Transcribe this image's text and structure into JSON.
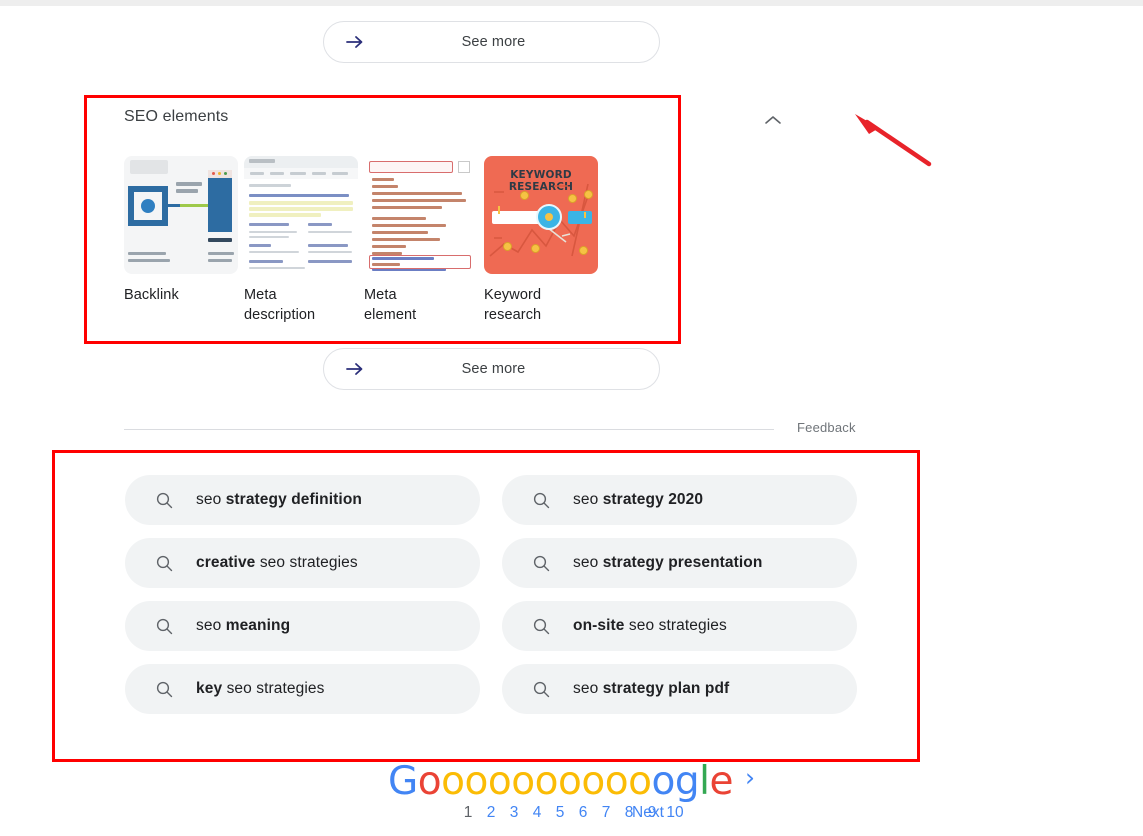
{
  "see_more_top": {
    "label": "See more",
    "icon": "arrow-right-icon"
  },
  "see_more_bottom": {
    "label": "See more",
    "icon": "arrow-right-icon"
  },
  "seo_elements": {
    "title": "SEO elements",
    "collapse_icon": "chevron-up-icon",
    "tiles": [
      {
        "label": "Backlink",
        "thumb": "backlink-diagram-thumbnail"
      },
      {
        "label": "Meta\ndescription",
        "label_line1": "Meta",
        "label_line2": "description",
        "thumb": "serp-result-thumbnail"
      },
      {
        "label": "Meta\nelement",
        "label_line1": "Meta",
        "label_line2": "element",
        "thumb": "html-code-thumbnail"
      },
      {
        "label": "Keyword\nresearch",
        "label_line1": "Keyword",
        "label_line2": "research",
        "thumb": "keyword-research-illustration-thumbnail"
      }
    ]
  },
  "keyword_research_art": {
    "heading": "KEYWORD RESEARCH"
  },
  "feedback": {
    "label": "Feedback"
  },
  "related_searches": {
    "chips": [
      {
        "icon": "search-icon",
        "plain_prefix": "seo ",
        "bold": "strategy definition",
        "plain_suffix": ""
      },
      {
        "icon": "search-icon",
        "plain_prefix": "",
        "bold": "creative",
        "plain_suffix": " seo strategies"
      },
      {
        "icon": "search-icon",
        "plain_prefix": "seo ",
        "bold": "meaning",
        "plain_suffix": ""
      },
      {
        "icon": "search-icon",
        "plain_prefix": "",
        "bold": "key",
        "plain_suffix": " seo strategies"
      },
      {
        "icon": "search-icon",
        "plain_prefix": "seo ",
        "bold": "strategy 2020",
        "plain_suffix": ""
      },
      {
        "icon": "search-icon",
        "plain_prefix": "seo ",
        "bold": "strategy presentation",
        "plain_suffix": ""
      },
      {
        "icon": "search-icon",
        "plain_prefix": "",
        "bold": "on-site",
        "plain_suffix": " seo strategies"
      },
      {
        "icon": "search-icon",
        "plain_prefix": "seo ",
        "bold": "strategy plan pdf",
        "plain_suffix": ""
      }
    ]
  },
  "pagination": {
    "logo_letters": [
      {
        "ch": "G",
        "color": "#4285f4"
      },
      {
        "ch": "o",
        "color": "#ea4335"
      },
      {
        "ch": "o",
        "color": "#fbbc05"
      },
      {
        "ch": "o",
        "color": "#fbbc05"
      },
      {
        "ch": "o",
        "color": "#fbbc05"
      },
      {
        "ch": "o",
        "color": "#fbbc05"
      },
      {
        "ch": "o",
        "color": "#fbbc05"
      },
      {
        "ch": "o",
        "color": "#fbbc05"
      },
      {
        "ch": "o",
        "color": "#fbbc05"
      },
      {
        "ch": "o",
        "color": "#fbbc05"
      },
      {
        "ch": "o",
        "color": "#fbbc05"
      },
      {
        "ch": "o",
        "color": "#4285f4"
      },
      {
        "ch": "g",
        "color": "#4285f4"
      },
      {
        "ch": "l",
        "color": "#34a853"
      },
      {
        "ch": "e",
        "color": "#ea4335"
      }
    ],
    "next_caret": "›",
    "pages": [
      "1",
      "2",
      "3",
      "4",
      "5",
      "6",
      "7",
      "8",
      "9",
      "10"
    ],
    "current_page": "1",
    "next_label": "Next"
  },
  "annotations": {
    "seo_box_color": "#ff0000",
    "related_box_color": "#ff0000",
    "arrow_color": "#e8232a",
    "arrow_name": "red-annotation-arrow"
  }
}
